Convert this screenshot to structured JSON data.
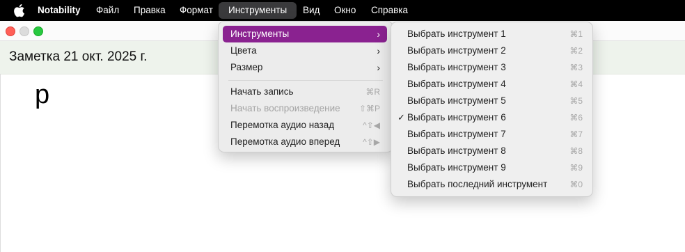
{
  "menubar": {
    "app": "Notability",
    "items": [
      "Файл",
      "Правка",
      "Формат",
      "Инструменты",
      "Вид",
      "Окно",
      "Справка"
    ],
    "active_index": 3
  },
  "note": {
    "title": "Заметка 21 окт. 2025 г.",
    "canvas_text": "р"
  },
  "tools_menu": {
    "items": [
      {
        "label": "Инструменты",
        "submenu": true,
        "highlighted": true
      },
      {
        "label": "Цвета",
        "submenu": true
      },
      {
        "label": "Размер",
        "submenu": true
      },
      {
        "label": "Начать запись",
        "shortcut": "⌘R"
      },
      {
        "label": "Начать воспроизведение",
        "shortcut": "⇧⌘P",
        "disabled": true
      },
      {
        "label": "Перемотка аудио назад",
        "shortcut": "^⇧◀"
      },
      {
        "label": "Перемотка аудио вперед",
        "shortcut": "^⇧▶"
      }
    ]
  },
  "tools_submenu": {
    "checked_index": 5,
    "items": [
      {
        "label": "Выбрать инструмент 1",
        "shortcut": "⌘1"
      },
      {
        "label": "Выбрать инструмент 2",
        "shortcut": "⌘2"
      },
      {
        "label": "Выбрать инструмент 3",
        "shortcut": "⌘3"
      },
      {
        "label": "Выбрать инструмент 4",
        "shortcut": "⌘4"
      },
      {
        "label": "Выбрать инструмент 5",
        "shortcut": "⌘5"
      },
      {
        "label": "Выбрать инструмент 6",
        "shortcut": "⌘6"
      },
      {
        "label": "Выбрать инструмент 7",
        "shortcut": "⌘7"
      },
      {
        "label": "Выбрать инструмент 8",
        "shortcut": "⌘8"
      },
      {
        "label": "Выбрать инструмент 9",
        "shortcut": "⌘9"
      },
      {
        "label": "Выбрать последний инструмент",
        "shortcut": "⌘0"
      }
    ]
  },
  "colors": {
    "highlight": "#8a2290",
    "menubar": "#000000",
    "note_header": "#eef3ec"
  }
}
